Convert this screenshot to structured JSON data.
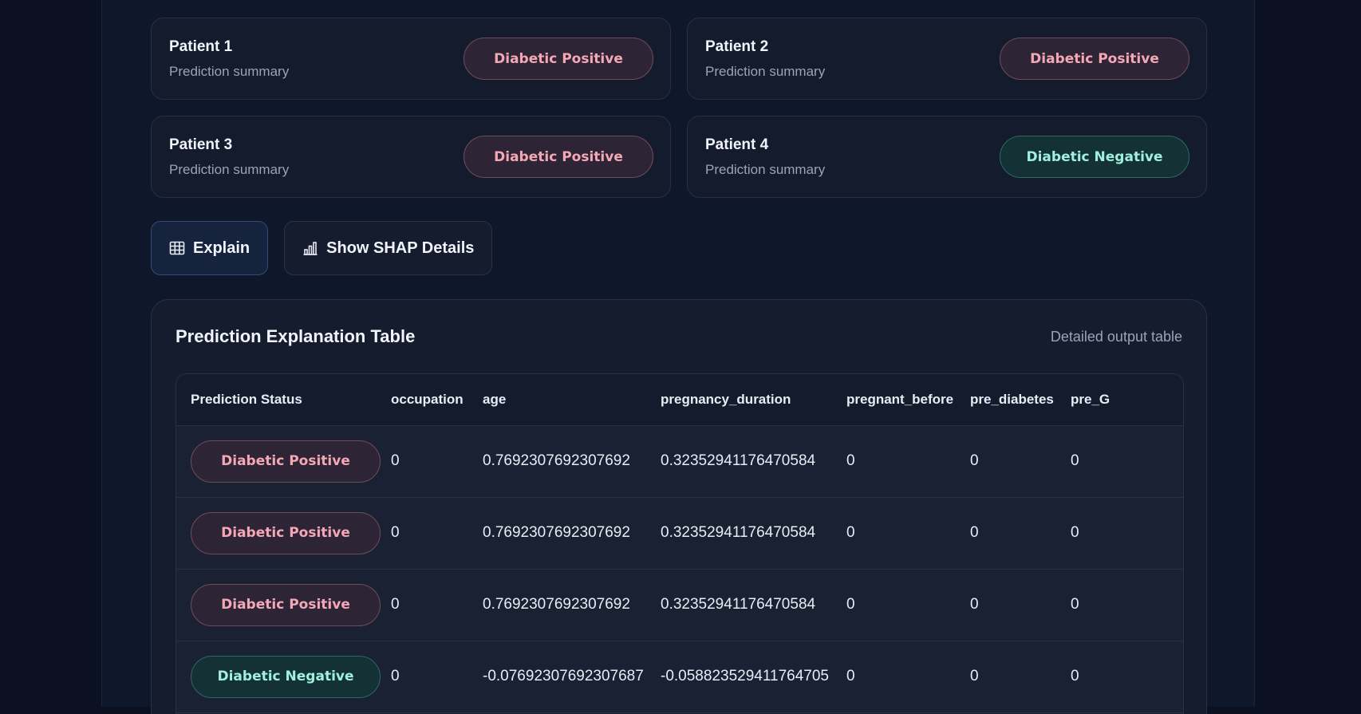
{
  "patients": [
    {
      "title": "Patient 1",
      "subtitle": "Prediction summary",
      "status": "Diabetic Positive",
      "kind": "pos"
    },
    {
      "title": "Patient 2",
      "subtitle": "Prediction summary",
      "status": "Diabetic Positive",
      "kind": "pos"
    },
    {
      "title": "Patient 3",
      "subtitle": "Prediction summary",
      "status": "Diabetic Positive",
      "kind": "pos"
    },
    {
      "title": "Patient 4",
      "subtitle": "Prediction summary",
      "status": "Diabetic Negative",
      "kind": "neg"
    }
  ],
  "actions": {
    "explain_label": "Explain",
    "explain_icon": "table-icon",
    "shap_label": "Show SHAP Details",
    "shap_icon": "bar-chart-icon"
  },
  "panel": {
    "title": "Prediction Explanation Table",
    "subtitle": "Detailed output table"
  },
  "table": {
    "columns": [
      "Prediction Status",
      "occupation",
      "age",
      "pregnancy_duration",
      "pregnant_before",
      "pre_diabetes",
      "pre_G"
    ],
    "rows": [
      {
        "status": "Diabetic Positive",
        "kind": "pos",
        "cells": [
          "0",
          "0.7692307692307692",
          "0.32352941176470584",
          "0",
          "0",
          "0"
        ]
      },
      {
        "status": "Diabetic Positive",
        "kind": "pos",
        "cells": [
          "0",
          "0.7692307692307692",
          "0.32352941176470584",
          "0",
          "0",
          "0"
        ]
      },
      {
        "status": "Diabetic Positive",
        "kind": "pos",
        "cells": [
          "0",
          "0.7692307692307692",
          "0.32352941176470584",
          "0",
          "0",
          "0"
        ]
      },
      {
        "status": "Diabetic Negative",
        "kind": "neg",
        "cells": [
          "0",
          "-0.07692307692307687",
          "-0.058823529411764705",
          "0",
          "0",
          "0"
        ]
      }
    ]
  },
  "colors": {
    "background": "#0f172a",
    "positive_text": "#f4a7b5",
    "negative_text": "#9ff0dc",
    "primary_button_border": "#2f4c78"
  }
}
